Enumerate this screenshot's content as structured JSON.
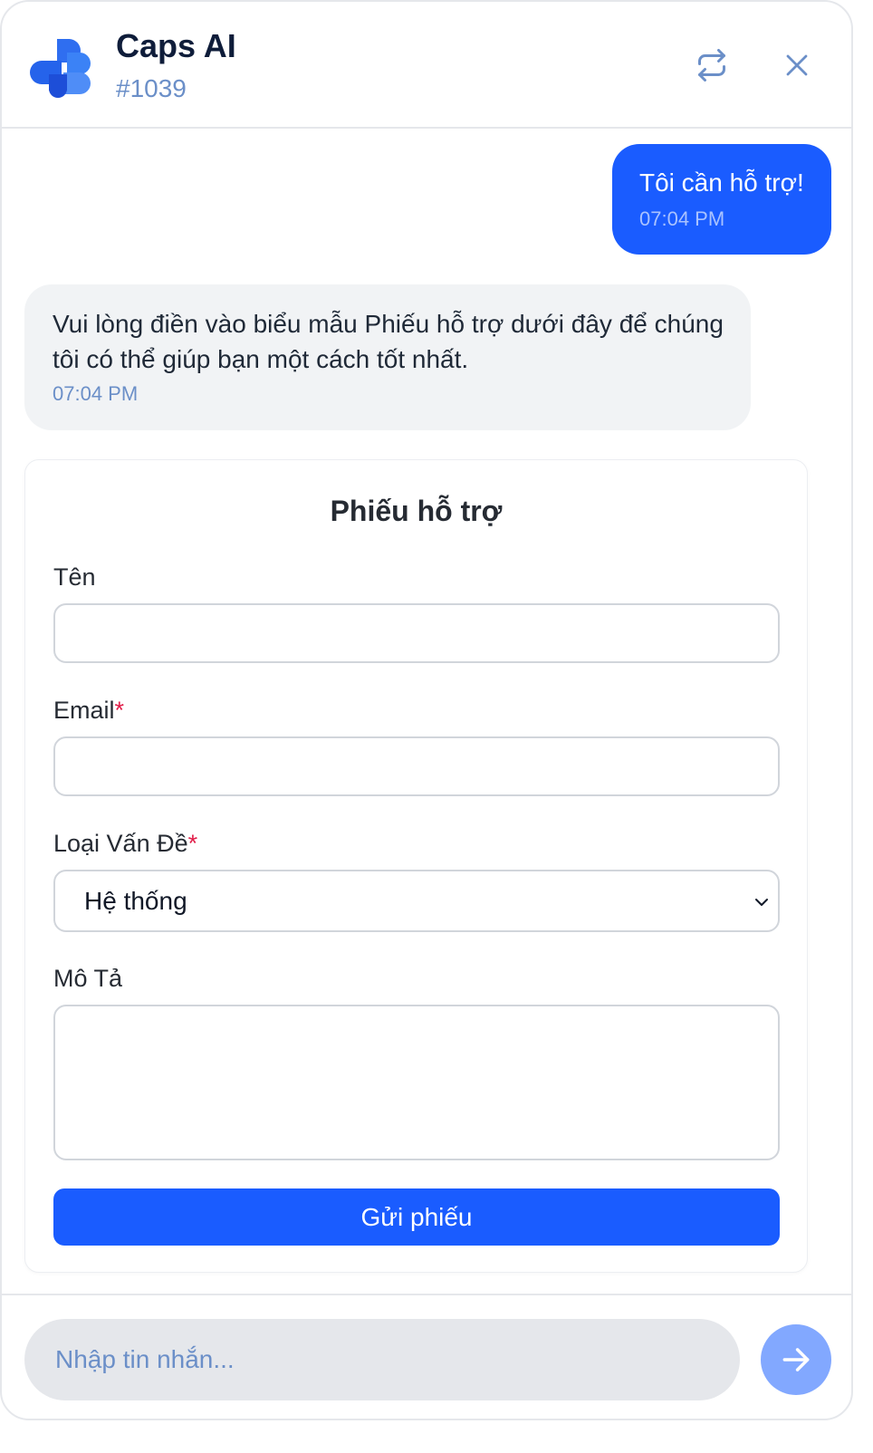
{
  "header": {
    "title": "Caps AI",
    "ticket_id": "#1039"
  },
  "messages": [
    {
      "from": "user",
      "text": "Tôi cần hỗ trợ!",
      "time": "07:04 PM"
    },
    {
      "from": "bot",
      "text": "Vui lòng điền vào biểu mẫu Phiếu hỗ trợ dưới đây để chúng tôi có thể giúp bạn một cách tốt nhất.",
      "time": "07:04 PM"
    }
  ],
  "form": {
    "title": "Phiếu hỗ trợ",
    "name_label": "Tên",
    "name_value": "",
    "email_label": "Email",
    "email_value": "",
    "required_mark": "*",
    "issue_type_label": "Loại Vấn Đề",
    "issue_type_selected": "Hệ thống",
    "description_label": "Mô Tả",
    "description_value": "",
    "submit_label": "Gửi phiếu"
  },
  "composer": {
    "placeholder": "Nhập tin nhắn..."
  },
  "colors": {
    "accent": "#1a5cff",
    "send_button": "#82a8ff",
    "required": "#e11d48",
    "muted_text": "#6b8fc8"
  },
  "icons": {
    "logo": "caps-ai-logo",
    "refresh": "refresh-icon",
    "close": "close-icon",
    "dropdown": "chevron-down-icon",
    "send": "arrow-right-icon"
  }
}
